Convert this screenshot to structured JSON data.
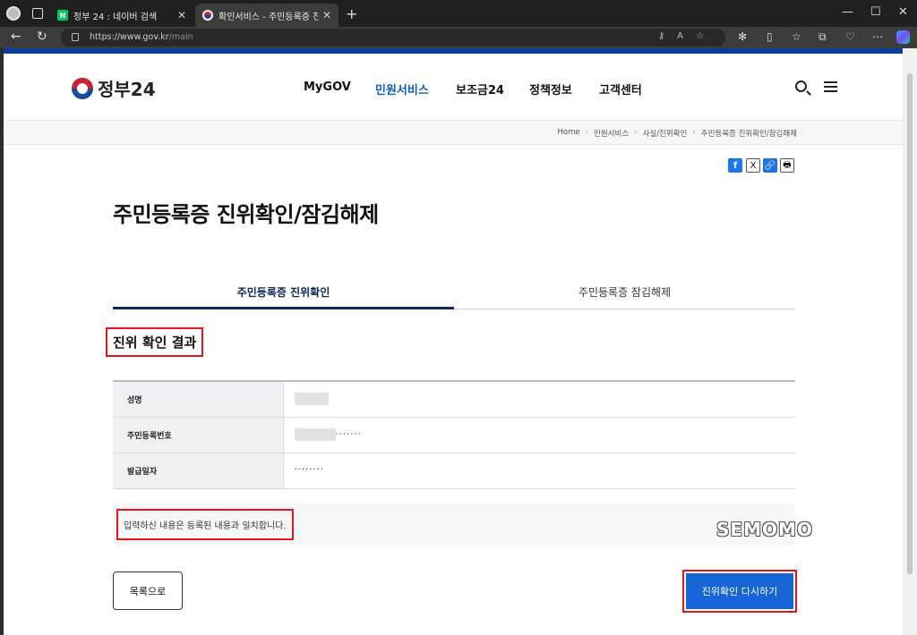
{
  "browser": {
    "tabs": [
      {
        "favicon": "naver-icon",
        "favicon_text": "N",
        "title": "정부 24 : 네이버 검색"
      },
      {
        "favicon": "gov-icon",
        "title": "확인서비스 - 주민등록증 진위확인"
      }
    ],
    "url_host": "https://www.gov.kr",
    "url_path": "/main"
  },
  "site": {
    "logo_text": "정부24",
    "nav": [
      "MyGOV",
      "민원서비스",
      "보조금24",
      "정책정보",
      "고객센터"
    ],
    "active_nav": "민원서비스"
  },
  "breadcrumb": [
    "Home",
    "민원서비스",
    "사실/진위확인",
    "주민등록증 진위확인/잠김해제"
  ],
  "share": {
    "facebook": "f",
    "x": "X",
    "link": "🔗",
    "print": "🖶"
  },
  "page": {
    "title": "주민등록증 진위확인/잠김해제",
    "tabs": [
      {
        "label": "주민등록증 진위확인",
        "active": true
      },
      {
        "label": "주민등록증 잠김해제",
        "active": false
      }
    ],
    "section_title": "진위 확인 결과",
    "rows": [
      {
        "label": "성명",
        "value": ""
      },
      {
        "label": "주민등록번호",
        "value": "·······"
      },
      {
        "label": "발급일자",
        "value": "········"
      }
    ],
    "notice": "입력하신 내용은 등록된 내용과 일치합니다.",
    "watermark": "SEMOMO",
    "list_button": "목록으로",
    "retry_button": "진위확인 다시하기"
  },
  "colors": {
    "accent": "#0b5fba",
    "highlight": "#e4161c",
    "primary_button": "#1565d8"
  }
}
